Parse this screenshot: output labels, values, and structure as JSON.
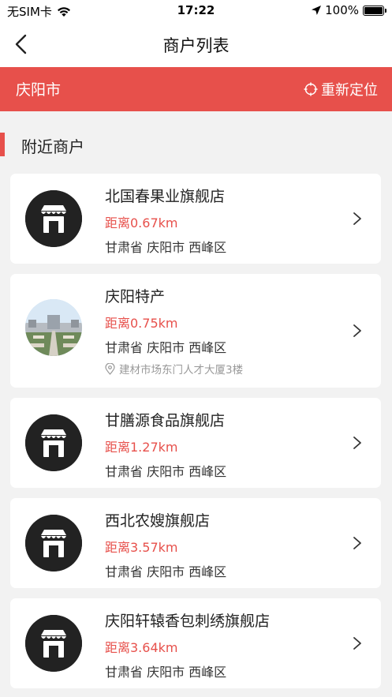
{
  "status_bar": {
    "carrier": "无SIM卡",
    "time": "17:22",
    "battery": "100%"
  },
  "nav": {
    "title": "商户列表"
  },
  "location": {
    "city": "庆阳市",
    "relocate_label": "重新定位"
  },
  "section": {
    "title": "附近商户"
  },
  "merchants": [
    {
      "name": "北国春果业旗舰店",
      "distance": "距离0.67km",
      "region": "甘肃省 庆阳市 西峰区",
      "address": ""
    },
    {
      "name": "庆阳特产",
      "distance": "距离0.75km",
      "region": "甘肃省 庆阳市 西峰区",
      "address": "建材市场东门人才大厦3楼"
    },
    {
      "name": "甘膳源食品旗舰店",
      "distance": "距离1.27km",
      "region": "甘肃省 庆阳市 西峰区",
      "address": ""
    },
    {
      "name": "西北农嫂旗舰店",
      "distance": "距离3.57km",
      "region": "甘肃省 庆阳市 西峰区",
      "address": ""
    },
    {
      "name": "庆阳轩辕香包刺绣旗舰店",
      "distance": "距离3.64km",
      "region": "甘肃省 庆阳市 西峰区",
      "address": ""
    }
  ],
  "colors": {
    "accent": "#e7504b",
    "background": "#f2f2f2",
    "card": "#ffffff"
  },
  "icons": {
    "back": "chevron-left-icon",
    "relocate": "crosshair-icon",
    "store": "store-awning-icon",
    "address": "location-pin-icon",
    "row_arrow": "chevron-right-icon"
  }
}
